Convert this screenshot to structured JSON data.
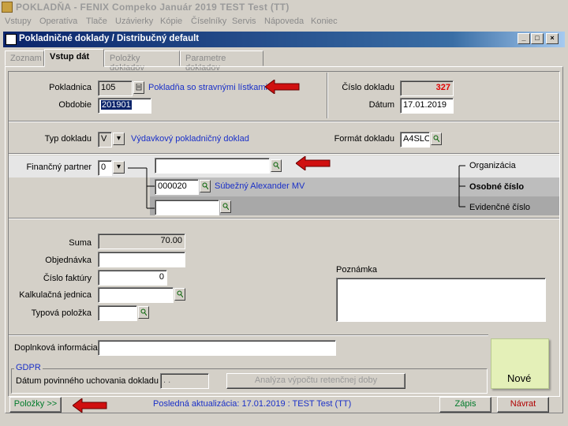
{
  "app": {
    "title": "POKLADŇA - FENIX Compeko  Január 2019  TEST Test  (TT)",
    "menu": [
      "Vstupy",
      "Operatíva",
      "Tlače",
      "Uzávierky",
      "Kópie",
      "Číselníky",
      "Servis",
      "Nápoveda",
      "Koniec"
    ]
  },
  "window": {
    "title": "Pokladničné doklady / Distribučný default",
    "controls": [
      "_",
      "□",
      "×"
    ]
  },
  "tabs": [
    "Zoznam",
    "Vstup dát",
    "Položky dokladov",
    "Parametre dokladov"
  ],
  "form": {
    "pokladnica_label": "Pokladnica",
    "pokladnica_value": "105",
    "pokladnica_name": "Pokladňa so stravnými lístkami",
    "obdobie_label": "Obdobie",
    "obdobie_value": "201901",
    "cislo_dokladu_label": "Číslo dokladu",
    "cislo_dokladu_value": "327",
    "datum_label": "Dátum",
    "datum_value": "17.01.2019",
    "typ_dokladu_label": "Typ dokladu",
    "typ_dokladu_value": "V",
    "typ_dokladu_name": "Výdavkový pokladničný doklad",
    "format_dokladu_label": "Formát dokladu",
    "format_dokladu_value": "A4SLO",
    "financny_partner_label": "Finančný partner",
    "financny_partner_value": "0",
    "partner_org_value": "",
    "partner_osobne_value": "000020",
    "partner_osobne_name": "Súbežný Alexander MV",
    "partner_evid_value": "",
    "opt_organizacia": "Organizácia",
    "opt_osobne_cislo": "Osobné číslo",
    "opt_evidencne_cislo": "Evidenčné číslo",
    "suma_label": "Suma",
    "suma_value": "70.00",
    "objednavka_label": "Objednávka",
    "objednavka_value": "",
    "cislo_faktury_label": "Číslo faktúry",
    "cislo_faktury_value": "0",
    "kalkulacna_jednica_label": "Kalkulačná jednica",
    "kalkulacna_jednica_value": "",
    "typova_polozka_label": "Typová položka",
    "typova_polozka_value": "",
    "poznamka_label": "Poznámka",
    "poznamka_value": "",
    "doplnkova_label": "Doplnková informácia",
    "doplnkova_value": "",
    "gdpr_label": "GDPR",
    "datum_uchovania_label": "Dátum povinného uchovania dokladu",
    "datum_uchovania_value": ". .",
    "analyza_button": "Analýza výpočtu retenčnej doby"
  },
  "footer": {
    "polozky_button": "Položky >>",
    "last_update": "Posledná aktualizácia: 17.01.2019 : TEST Test  (TT)",
    "zapis_button": "Zápis",
    "navrat_button": "Návrat"
  },
  "sticky_note": "Nové",
  "colors": {
    "titlebar_start": "#0a246a",
    "link_blue": "#1a30c8",
    "doc_number_red": "#e00000",
    "arrow_red": "#d01010",
    "note_bg": "#e4f0b8"
  }
}
